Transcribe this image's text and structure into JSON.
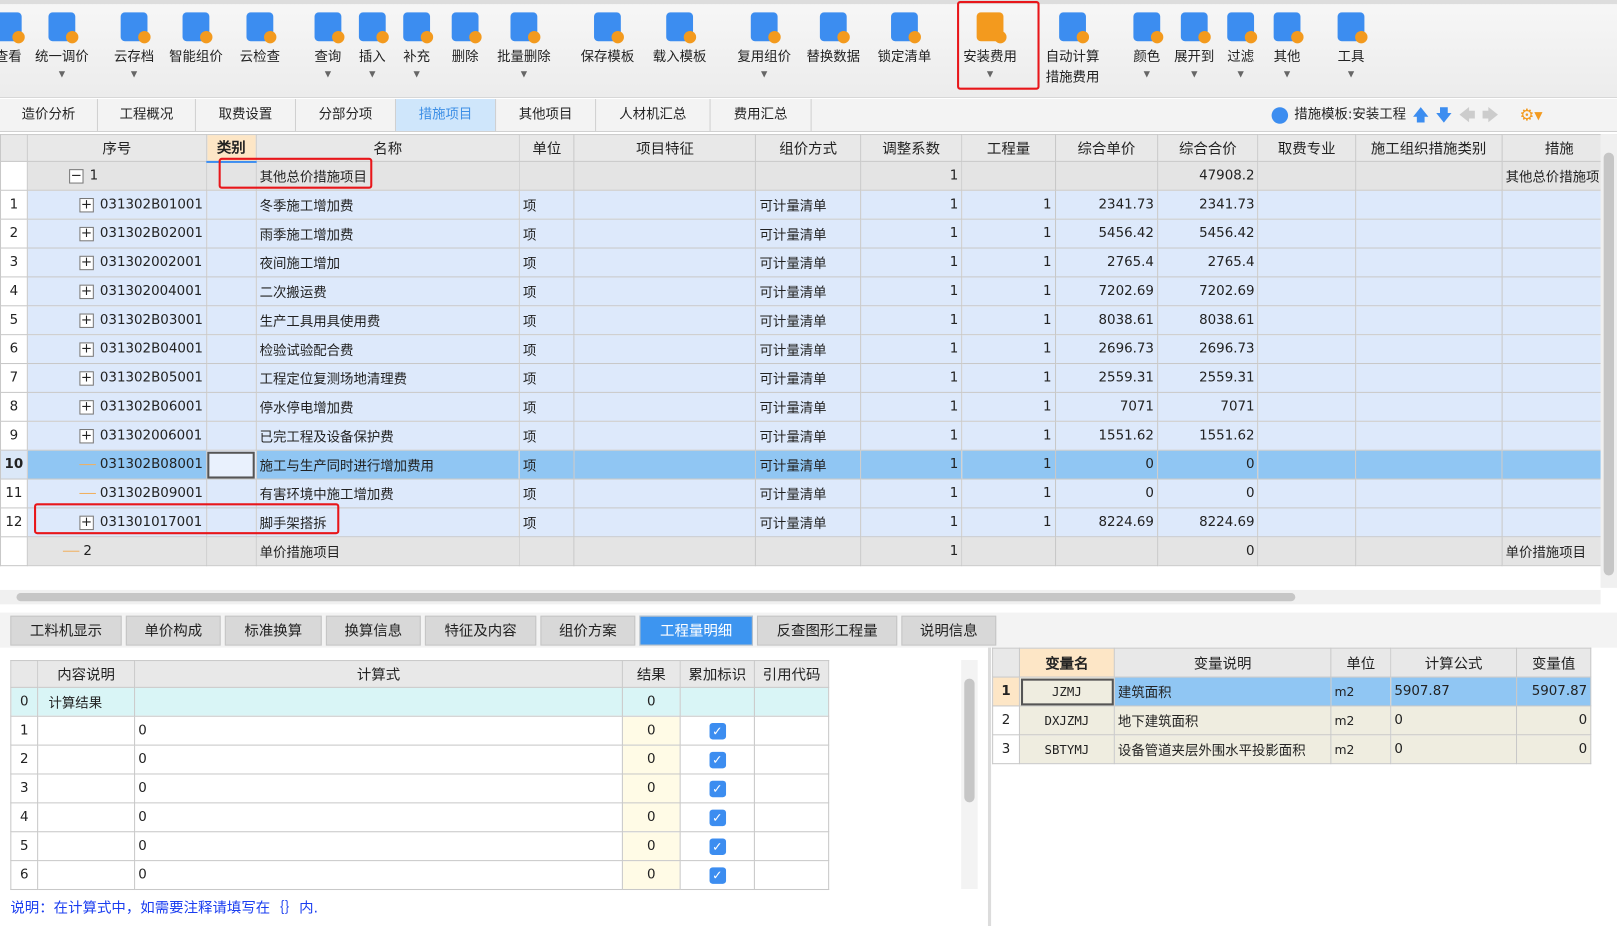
{
  "toolbar": {
    "items": [
      {
        "label": "查看",
        "arrow": false,
        "icon": "view-icon"
      },
      {
        "label": "统一调价",
        "arrow": true,
        "icon": "unified-price-icon"
      },
      {
        "label": "云存档",
        "arrow": true,
        "icon": "cloud-upload-icon"
      },
      {
        "label": "智能组价",
        "arrow": false,
        "icon": "smart-pricing-icon"
      },
      {
        "label": "云检查",
        "arrow": false,
        "icon": "cloud-check-icon"
      },
      {
        "label": "查询",
        "arrow": true,
        "icon": "query-icon"
      },
      {
        "label": "插入",
        "arrow": true,
        "icon": "insert-icon"
      },
      {
        "label": "补充",
        "arrow": true,
        "icon": "supplement-icon"
      },
      {
        "label": "删除",
        "arrow": false,
        "icon": "trash-icon"
      },
      {
        "label": "批量删除",
        "arrow": true,
        "icon": "batch-delete-icon"
      },
      {
        "label": "保存模板",
        "arrow": false,
        "icon": "save-template-icon"
      },
      {
        "label": "载入模板",
        "arrow": false,
        "icon": "load-template-icon"
      },
      {
        "label": "复用组价",
        "arrow": true,
        "icon": "reuse-pricing-icon"
      },
      {
        "label": "替换数据",
        "arrow": false,
        "icon": "replace-data-icon"
      },
      {
        "label": "锁定清单",
        "arrow": false,
        "icon": "lock-icon"
      },
      {
        "label": "安装费用",
        "arrow": true,
        "icon": "install-fee-icon"
      },
      {
        "label": "自动计算\n措施费用",
        "arrow": false,
        "icon": "auto-calc-icon"
      },
      {
        "label": "颜色",
        "arrow": true,
        "icon": "paint-bucket-icon"
      },
      {
        "label": "展开到",
        "arrow": true,
        "icon": "expand-tree-icon"
      },
      {
        "label": "过滤",
        "arrow": true,
        "icon": "filter-icon"
      },
      {
        "label": "其他",
        "arrow": true,
        "icon": "grid-icon"
      },
      {
        "label": "工具",
        "arrow": true,
        "icon": "tools-icon"
      }
    ]
  },
  "tabs": [
    "造价分析",
    "工程概况",
    "取费设置",
    "分部分项",
    "措施项目",
    "其他项目",
    "人材机汇总",
    "费用汇总"
  ],
  "active_tab": 4,
  "template_label": "措施模板:安装工程",
  "main_table": {
    "columns": [
      "",
      "序号",
      "类别",
      "名称",
      "单位",
      "项目特征",
      "组价方式",
      "调整系数",
      "工程量",
      "综合单价",
      "综合合价",
      "取费专业",
      "施工组织措施类别",
      "措施"
    ],
    "rows": [
      {
        "rn": "",
        "code": "1",
        "exp": "−",
        "kind": "group",
        "name": "其他总价措施项目",
        "unit": "",
        "feature": "",
        "method": "",
        "coef": "1",
        "qty": "",
        "price": "",
        "total": "47908.2",
        "fee": "",
        "org": "",
        "measure": "其他总价措施项目"
      },
      {
        "rn": "1",
        "code": "031302B01001",
        "exp": "+",
        "kind": "item",
        "name": "冬季施工增加费",
        "unit": "项",
        "feature": "",
        "method": "可计量清单",
        "coef": "1",
        "qty": "1",
        "price": "2341.73",
        "total": "2341.73",
        "fee": "",
        "org": "",
        "measure": ""
      },
      {
        "rn": "2",
        "code": "031302B02001",
        "exp": "+",
        "kind": "item",
        "name": "雨季施工增加费",
        "unit": "项",
        "feature": "",
        "method": "可计量清单",
        "coef": "1",
        "qty": "1",
        "price": "5456.42",
        "total": "5456.42",
        "fee": "",
        "org": "",
        "measure": ""
      },
      {
        "rn": "3",
        "code": "031302002001",
        "exp": "+",
        "kind": "item",
        "name": "夜间施工增加",
        "unit": "项",
        "feature": "",
        "method": "可计量清单",
        "coef": "1",
        "qty": "1",
        "price": "2765.4",
        "total": "2765.4",
        "fee": "",
        "org": "",
        "measure": ""
      },
      {
        "rn": "4",
        "code": "031302004001",
        "exp": "+",
        "kind": "item",
        "name": "二次搬运费",
        "unit": "项",
        "feature": "",
        "method": "可计量清单",
        "coef": "1",
        "qty": "1",
        "price": "7202.69",
        "total": "7202.69",
        "fee": "",
        "org": "",
        "measure": ""
      },
      {
        "rn": "5",
        "code": "031302B03001",
        "exp": "+",
        "kind": "item",
        "name": "生产工具用具使用费",
        "unit": "项",
        "feature": "",
        "method": "可计量清单",
        "coef": "1",
        "qty": "1",
        "price": "8038.61",
        "total": "8038.61",
        "fee": "",
        "org": "",
        "measure": ""
      },
      {
        "rn": "6",
        "code": "031302B04001",
        "exp": "+",
        "kind": "item",
        "name": "检验试验配合费",
        "unit": "项",
        "feature": "",
        "method": "可计量清单",
        "coef": "1",
        "qty": "1",
        "price": "2696.73",
        "total": "2696.73",
        "fee": "",
        "org": "",
        "measure": ""
      },
      {
        "rn": "7",
        "code": "031302B05001",
        "exp": "+",
        "kind": "item",
        "name": "工程定位复测场地清理费",
        "unit": "项",
        "feature": "",
        "method": "可计量清单",
        "coef": "1",
        "qty": "1",
        "price": "2559.31",
        "total": "2559.31",
        "fee": "",
        "org": "",
        "measure": ""
      },
      {
        "rn": "8",
        "code": "031302B06001",
        "exp": "+",
        "kind": "item",
        "name": "停水停电增加费",
        "unit": "项",
        "feature": "",
        "method": "可计量清单",
        "coef": "1",
        "qty": "1",
        "price": "7071",
        "total": "7071",
        "fee": "",
        "org": "",
        "measure": ""
      },
      {
        "rn": "9",
        "code": "031302006001",
        "exp": "+",
        "kind": "item",
        "name": "已完工程及设备保护费",
        "unit": "项",
        "feature": "",
        "method": "可计量清单",
        "coef": "1",
        "qty": "1",
        "price": "1551.62",
        "total": "1551.62",
        "fee": "",
        "org": "",
        "measure": ""
      },
      {
        "rn": "10",
        "code": "031302B08001",
        "exp": "",
        "kind": "sel",
        "name": "施工与生产同时进行增加费用",
        "unit": "项",
        "feature": "",
        "method": "可计量清单",
        "coef": "1",
        "qty": "1",
        "price": "0",
        "total": "0",
        "fee": "",
        "org": "",
        "measure": ""
      },
      {
        "rn": "11",
        "code": "031302B09001",
        "exp": "",
        "kind": "item",
        "name": "有害环境中施工增加费",
        "unit": "项",
        "feature": "",
        "method": "可计量清单",
        "coef": "1",
        "qty": "1",
        "price": "0",
        "total": "0",
        "fee": "",
        "org": "",
        "measure": ""
      },
      {
        "rn": "12",
        "code": "031301017001",
        "exp": "+",
        "kind": "item",
        "name": "脚手架搭拆",
        "unit": "项",
        "feature": "",
        "method": "可计量清单",
        "coef": "1",
        "qty": "1",
        "price": "8224.69",
        "total": "8224.69",
        "fee": "",
        "org": "",
        "measure": ""
      },
      {
        "rn": "",
        "code": "2",
        "exp": "",
        "kind": "group",
        "name": "单价措施项目",
        "unit": "",
        "feature": "",
        "method": "",
        "coef": "1",
        "qty": "",
        "price": "",
        "total": "0",
        "fee": "",
        "org": "",
        "measure": "单价措施项目"
      }
    ]
  },
  "bottom_tabs": [
    "工料机显示",
    "单价构成",
    "标准换算",
    "换算信息",
    "特征及内容",
    "组价方案",
    "工程量明细",
    "反查图形工程量",
    "说明信息"
  ],
  "active_bottom_tab": 6,
  "detail_table": {
    "columns": [
      "",
      "内容说明",
      "计算式",
      "结果",
      "累加标识",
      "引用代码"
    ],
    "rows": [
      {
        "rn": "0",
        "desc": "计算结果",
        "formula": "",
        "result": "0",
        "checked": false,
        "code": ""
      },
      {
        "rn": "1",
        "desc": "",
        "formula": "0",
        "result": "0",
        "checked": true,
        "code": ""
      },
      {
        "rn": "2",
        "desc": "",
        "formula": "0",
        "result": "0",
        "checked": true,
        "code": ""
      },
      {
        "rn": "3",
        "desc": "",
        "formula": "0",
        "result": "0",
        "checked": true,
        "code": ""
      },
      {
        "rn": "4",
        "desc": "",
        "formula": "0",
        "result": "0",
        "checked": true,
        "code": ""
      },
      {
        "rn": "5",
        "desc": "",
        "formula": "0",
        "result": "0",
        "checked": true,
        "code": ""
      },
      {
        "rn": "6",
        "desc": "",
        "formula": "0",
        "result": "0",
        "checked": true,
        "code": ""
      }
    ]
  },
  "note": "说明：在计算式中，如需要注释请填写在｛｝内.",
  "var_table": {
    "columns": [
      "",
      "变量名",
      "变量说明",
      "单位",
      "计算公式",
      "变量值"
    ],
    "rows": [
      {
        "rn": "1",
        "name": "JZMJ",
        "desc": "建筑面积",
        "unit": "m2",
        "formula": "5907.87",
        "value": "5907.87"
      },
      {
        "rn": "2",
        "name": "DXJZMJ",
        "desc": "地下建筑面积",
        "unit": "m2",
        "formula": "0",
        "value": "0"
      },
      {
        "rn": "3",
        "name": "SBTYMJ",
        "desc": "设备管道夹层外围水平投影面积",
        "unit": "m2",
        "formula": "0",
        "value": "0"
      }
    ]
  }
}
